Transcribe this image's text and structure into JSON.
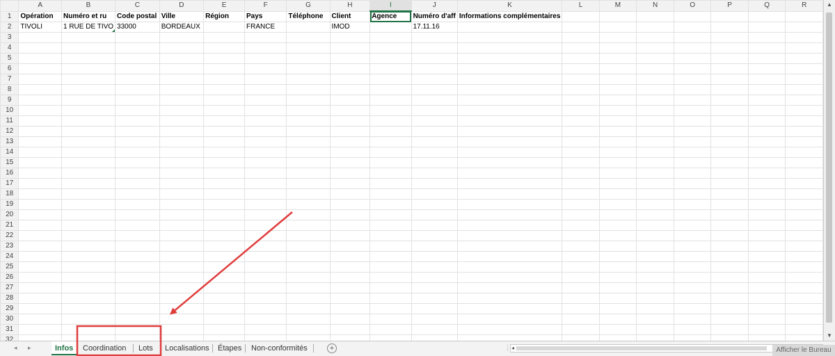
{
  "sheet": {
    "columns": [
      "A",
      "B",
      "C",
      "D",
      "E",
      "F",
      "G",
      "H",
      "I",
      "J",
      "K",
      "L",
      "M",
      "N",
      "O",
      "P",
      "Q",
      "R"
    ],
    "selected_column": "I",
    "header_row": [
      "Opération",
      "Numéro et ru",
      "Code postal",
      "Ville",
      "Région",
      "Pays",
      "Téléphone",
      "Client",
      "Agence",
      "Numéro d'aff",
      "Informations complémentaires",
      "",
      "",
      "",
      "",
      "",
      "",
      ""
    ],
    "data_row": [
      "TIVOLI",
      "1 RUE DE TIVO",
      "33000",
      "BORDEAUX",
      "",
      "FRANCE",
      "",
      "IMOD",
      "",
      "17.11.16",
      "",
      "",
      "",
      "",
      "",
      "",
      "",
      ""
    ],
    "row_numbers": [
      "1",
      "2",
      "3",
      "4",
      "5",
      "6",
      "7",
      "8",
      "9",
      "10",
      "11",
      "12",
      "13",
      "14",
      "15",
      "16",
      "17",
      "18",
      "19",
      "20",
      "21",
      "22",
      "23",
      "24",
      "25",
      "26",
      "27",
      "28",
      "29",
      "30",
      "31",
      "32"
    ]
  },
  "tabs": [
    {
      "label": "Infos",
      "active": true
    },
    {
      "label": "Coordination",
      "active": false
    },
    {
      "label": "Lots",
      "active": false
    },
    {
      "label": "Localisations",
      "active": false
    },
    {
      "label": "Étapes",
      "active": false
    },
    {
      "label": "Non-conformités",
      "active": false
    }
  ],
  "nav": {
    "prev": "◂",
    "next": "▸"
  },
  "add_sheet": "+",
  "desktop_button": "Afficher le Bureau",
  "annotation": {
    "color": "#e03c3c"
  }
}
